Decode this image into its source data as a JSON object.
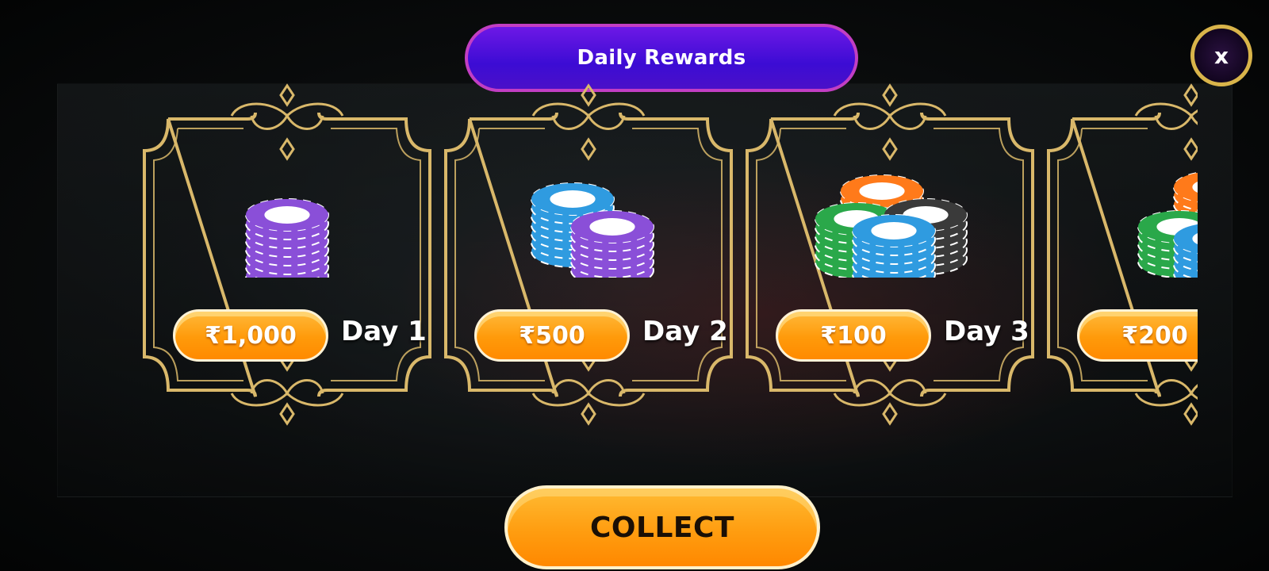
{
  "header": {
    "title": "Daily Rewards"
  },
  "close_button": {
    "label": "x"
  },
  "rewards": [
    {
      "amount": "₹1,000",
      "day": "Day 1",
      "chip_colors": [
        "#8a4fd8"
      ]
    },
    {
      "amount": "₹500",
      "day": "Day 2",
      "chip_colors": [
        "#2f9be0",
        "#8a4fd8"
      ]
    },
    {
      "amount": "₹100",
      "day": "Day 3",
      "chip_colors": [
        "#ff7a1a",
        "#2aa84a",
        "#3a3a3a",
        "#2f9be0"
      ]
    },
    {
      "amount": "₹200",
      "day": "",
      "chip_colors": [
        "#ff7a1a",
        "#2aa84a",
        "#2f9be0"
      ]
    }
  ],
  "collect_button": {
    "label": "COLLECT"
  },
  "colors": {
    "gold_frame": "#d9b86a",
    "header_bg": "#4a10d8",
    "header_border": "#c23ec3",
    "button_orange": "#ff9a0a"
  }
}
